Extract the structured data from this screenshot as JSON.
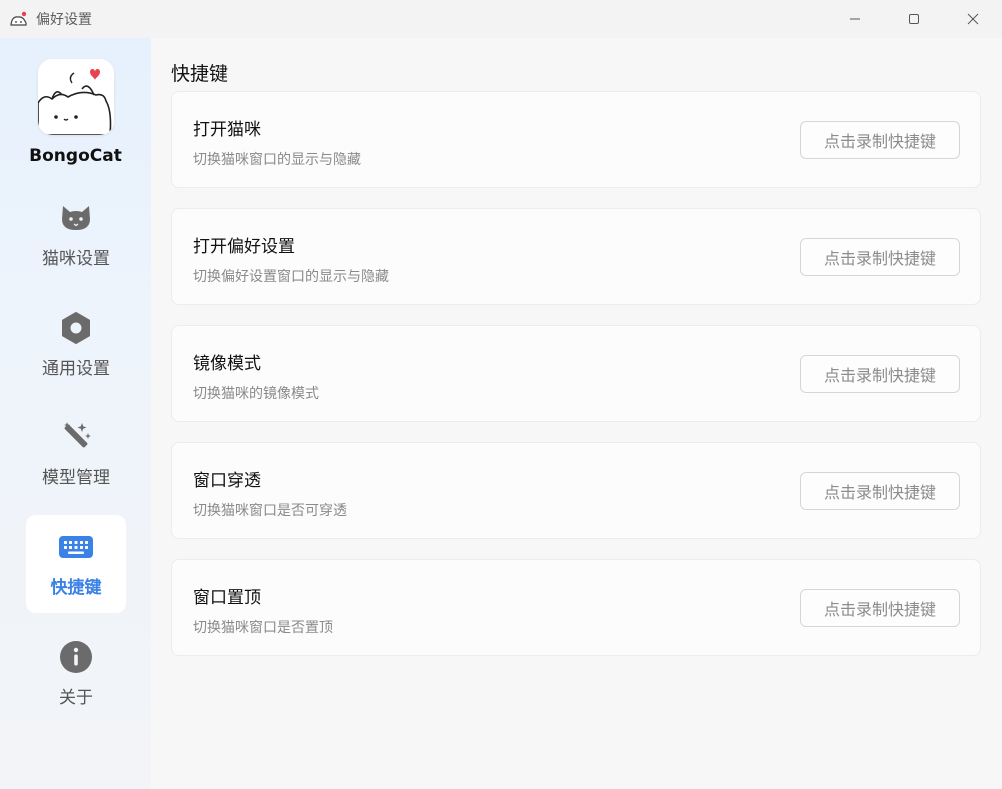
{
  "window": {
    "title": "偏好设置",
    "icons": {
      "app": "bongocat-icon",
      "minimize": "minimize-icon",
      "maximize": "maximize-icon",
      "close": "close-icon"
    }
  },
  "sidebar": {
    "app_name": "BongoCat",
    "items": [
      {
        "label": "猫咪设置",
        "icon": "cat-icon",
        "active": false
      },
      {
        "label": "通用设置",
        "icon": "hexagon-settings-icon",
        "active": false
      },
      {
        "label": "模型管理",
        "icon": "magic-wand-icon",
        "active": false
      },
      {
        "label": "快捷键",
        "icon": "keyboard-icon",
        "active": true
      },
      {
        "label": "关于",
        "icon": "info-icon",
        "active": false
      }
    ]
  },
  "main": {
    "section_title": "快捷键",
    "shortcuts": [
      {
        "title": "打开猫咪",
        "description": "切换猫咪窗口的显示与隐藏",
        "button_label": "点击录制快捷键"
      },
      {
        "title": "打开偏好设置",
        "description": "切换偏好设置窗口的显示与隐藏",
        "button_label": "点击录制快捷键"
      },
      {
        "title": "镜像模式",
        "description": "切换猫咪的镜像模式",
        "button_label": "点击录制快捷键"
      },
      {
        "title": "窗口穿透",
        "description": "切换猫咪窗口是否可穿透",
        "button_label": "点击录制快捷键"
      },
      {
        "title": "窗口置顶",
        "description": "切换猫咪窗口是否置顶",
        "button_label": "点击录制快捷键"
      }
    ]
  },
  "colors": {
    "accent": "#3b82e6",
    "icon_gray": "#6b6b6b",
    "heart": "#e8414f"
  }
}
